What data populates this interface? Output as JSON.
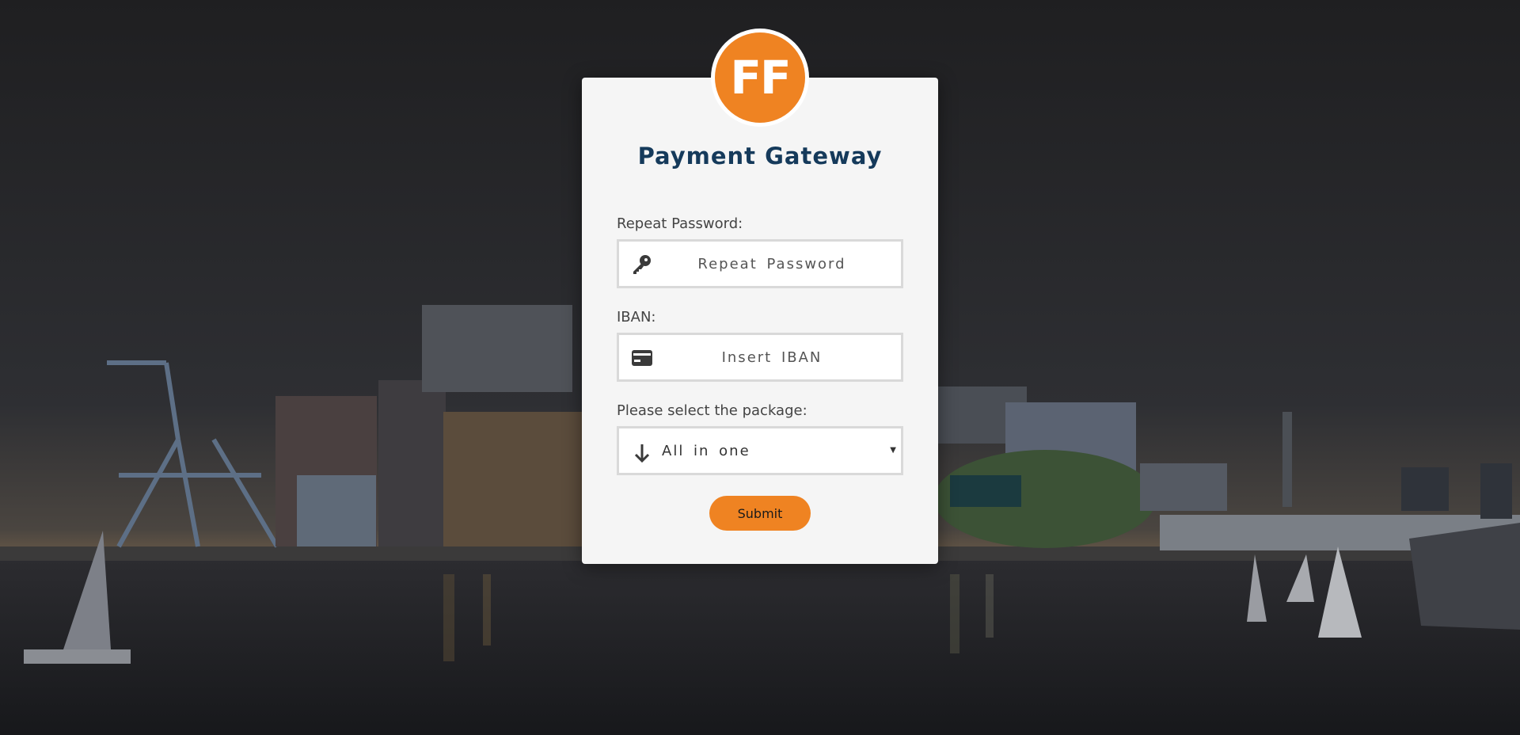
{
  "logo": {
    "text": "FF"
  },
  "form": {
    "title": "Payment Gateway",
    "repeat_password": {
      "label": "Repeat Password:",
      "placeholder": "Repeat Password",
      "icon": "key-icon"
    },
    "iban": {
      "label": "IBAN:",
      "placeholder": "Insert IBAN",
      "icon": "credit-card-icon"
    },
    "package": {
      "label": "Please select the package:",
      "selected": "All in one",
      "icon": "arrow-down-icon"
    },
    "submit_label": "Submit"
  },
  "colors": {
    "accent": "#ef8322",
    "title": "#153a5b",
    "card": "#f5f5f5"
  }
}
